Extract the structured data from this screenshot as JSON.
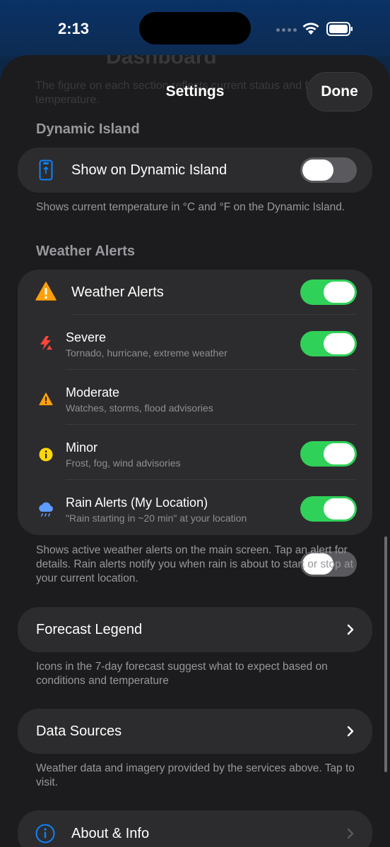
{
  "status_bar": {
    "time": "2:13"
  },
  "sheet": {
    "title": "Settings",
    "done_label": "Done",
    "background_title": "Dashboard",
    "background_text": "The figure on each section reflects current status and feels-like temperature."
  },
  "dynamic_island_section": {
    "header": "Dynamic Island",
    "row_label": "Show on Dynamic Island",
    "toggle_on": false,
    "footer": "Shows current temperature in °C and °F on the Dynamic Island."
  },
  "weather_alerts_section": {
    "header": "Weather Alerts",
    "main_row_label": "Weather Alerts",
    "main_toggle_on": true,
    "items": [
      {
        "title": "Severe",
        "subtitle": "Tornado, hurricane, extreme weather",
        "icon": "severe-weather-icon",
        "on": true
      },
      {
        "title": "Moderate",
        "subtitle": "Watches, storms, flood advisories",
        "icon": "warning-triangle-icon",
        "on": true
      },
      {
        "title": "Minor",
        "subtitle": "Frost, fog, wind advisories",
        "icon": "info-circle-icon",
        "on": true
      },
      {
        "title": "Rain Alerts (My Location)",
        "subtitle": "\"Rain starting in ~20 min\" at your location",
        "icon": "rain-cloud-icon",
        "on": false
      }
    ],
    "footer": "Shows active weather alerts on the main screen. Tap an alert for details. Rain alerts notify you when rain is about to start or stop at your current location."
  },
  "forecast_legend": {
    "label": "Forecast Legend",
    "footer": "Icons in the 7-day forecast suggest what to expect based on conditions and temperature"
  },
  "data_sources": {
    "label": "Data Sources",
    "footer": "Weather data and imagery provided by the services above. Tap to visit."
  },
  "about": {
    "label": "About & Info"
  },
  "colors": {
    "toggle_on": "#30d158",
    "toggle_off": "#5a5a5e",
    "accent_blue": "#0a84ff",
    "alert_orange": "#ff9f0a",
    "severe_red": "#ff453a",
    "minor_yellow": "#ffd60a"
  }
}
